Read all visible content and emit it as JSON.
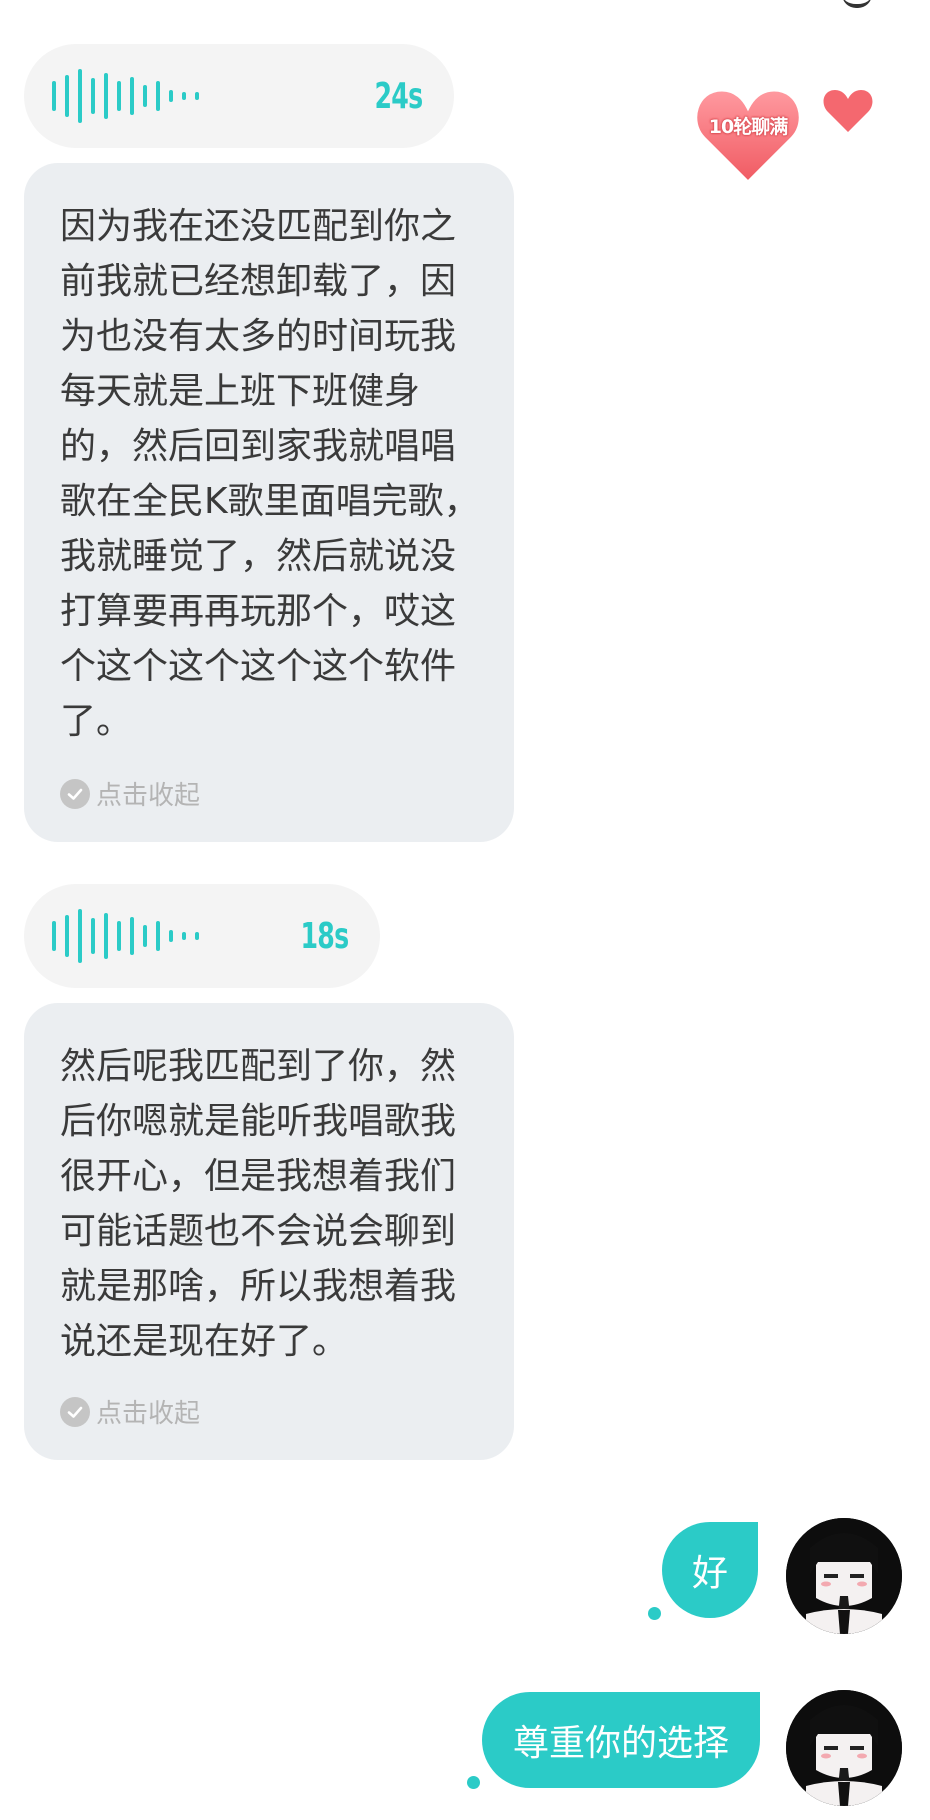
{
  "messages": [
    {
      "voice_duration": "24s",
      "transcript": "因为我在还没匹配到你之前我就已经想卸载了，因为也没有太多的时间玩我每天就是上班下班健身的，然后回到家我就唱唱歌在全民K歌里面唱完歌，我就睡觉了，然后就说没打算要再再玩那个，哎这个这个这个这个这个软件了。",
      "collapse_label": "点击收起"
    },
    {
      "voice_duration": "18s",
      "transcript": "然后呢我匹配到了你，然后你嗯就是能听我唱歌我很开心，但是我想着我们可能话题也不会说会聊到就是那啥，所以我想着我说还是现在好了。",
      "collapse_label": "点击收起"
    }
  ],
  "badge": {
    "label": "10轮聊满"
  },
  "replies": [
    {
      "text": "好"
    },
    {
      "text": "尊重你的选择"
    }
  ],
  "colors": {
    "accent": "#2bcbc7",
    "heart": "#f4686f",
    "bubble_voice": "#f4f4f4",
    "bubble_text": "#ebeef1"
  },
  "icons": [
    "voice-waveform-icon",
    "check-circle-icon",
    "heart-icon",
    "heart-badge-icon",
    "avatar"
  ]
}
